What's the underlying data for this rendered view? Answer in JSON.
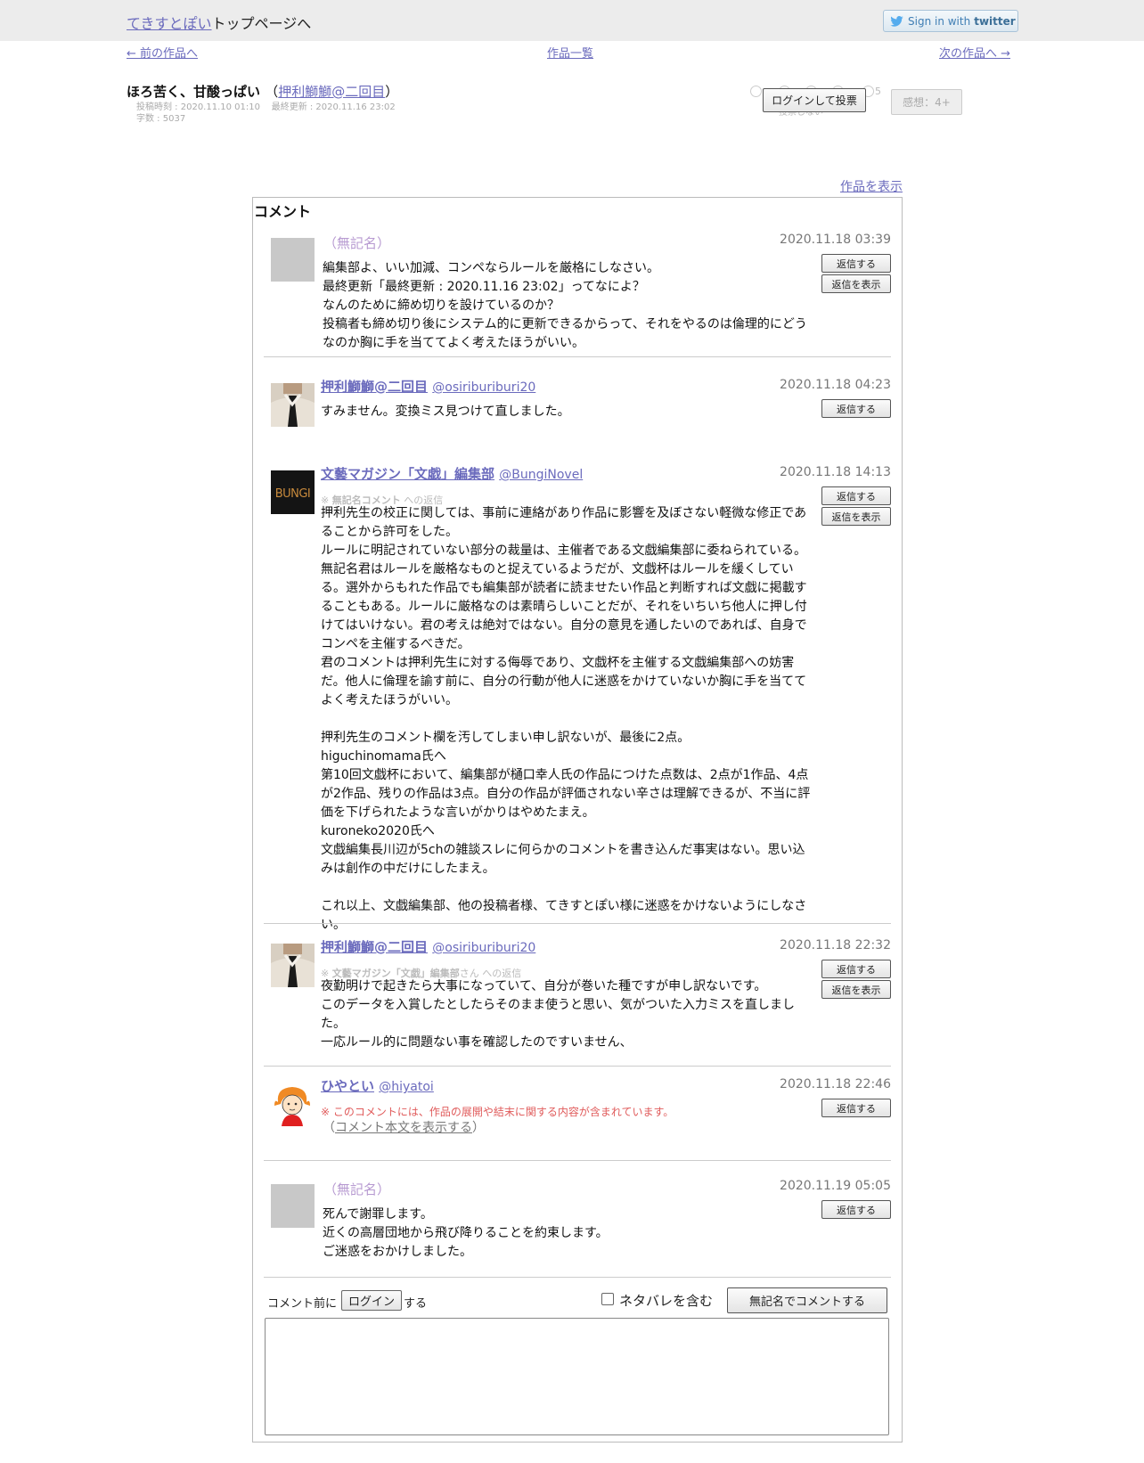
{
  "header": {
    "site_name": "てきすとぽい",
    "site_suffix": "トップページへ",
    "twitter_signin": "Sign in with",
    "twitter_brand": "twitter"
  },
  "nav": {
    "prev": "← 前の作品へ",
    "list": "作品一覧",
    "next": "次の作品へ →"
  },
  "work": {
    "title": "ほろ苦く、甘酸っぱい",
    "paren_open": "（",
    "author": "押利鰤鰤@二回目",
    "paren_close": "）",
    "posted": "投稿時刻 : 2020.11.10 01:10",
    "updated": "最終更新 : 2020.11.16 23:02",
    "chars": "字数 : 5037"
  },
  "vote": {
    "scale_max": "5",
    "no_vote": "投票しない",
    "login_button": "ログインして投票",
    "impression_button": "感想：4+"
  },
  "show_work": "作品を表示",
  "comments_heading": "コメント",
  "comments": [
    {
      "author": "（無記名）",
      "handle": "",
      "date": "2020.11.18 03:39",
      "reply_label": "返信する",
      "show_replies_label": "返信を表示",
      "body": "編集部よ、いい加減、コンペならルールを厳格にしなさい。\n最終更新「最終更新 : 2020.11.16 23:02」ってなによ？\nなんのために締め切りを設けているのか？\n投稿者も締め切り後にシステム的に更新できるからって、それをやるのは倫理的にどうなのか胸に手を当ててよく考えたほうがいい。"
    },
    {
      "author": "押利鰤鰤@二回目",
      "handle": "@osiriburiburi20",
      "date": "2020.11.18 04:23",
      "reply_label": "返信する",
      "body": "すみません。変換ミス見つけて直しました。"
    },
    {
      "author": "文藝マガジン「文戯」編集部",
      "handle": "@BungiNovel",
      "date": "2020.11.18 14:13",
      "reply_label": "返信する",
      "show_replies_label": "返信を表示",
      "reply_to_prefix": "※ ",
      "reply_to_name": "無記名コメント",
      "reply_to_suffix": " への返信",
      "avatar_text": "BUNGI",
      "body": "押利先生の校正に関しては、事前に連絡があり作品に影響を及ぼさない軽微な修正であることから許可をした。\nルールに明記されていない部分の裁量は、主催者である文戯編集部に委ねられている。\n無記名君はルールを厳格なものと捉えているようだが、文戯杯はルールを緩くしている。選外からもれた作品でも編集部が読者に読ませたい作品と判断すれば文戯に掲載することもある。ルールに厳格なのは素晴らしいことだが、それをいちいち他人に押し付けてはいけない。君の考えは絶対ではない。自分の意見を通したいのであれば、自身でコンペを主催するべきだ。\n君のコメントは押利先生に対する侮辱であり、文戯杯を主催する文戯編集部への妨害だ。他人に倫理を諭す前に、自分の行動が他人に迷惑をかけていないか胸に手を当ててよく考えたほうがいい。\n\n押利先生のコメント欄を汚してしまい申し訳ないが、最後に2点。\nhiguchinomama氏へ\n第10回文戯杯において、編集部が樋口幸人氏の作品につけた点数は、2点が1作品、4点が2作品、残りの作品は3点。自分の作品が評価されない辛さは理解できるが、不当に評価を下げられたような言いがかりはやめたまえ。\nkuroneko2020氏へ\n文戯編集長川辺が5chの雑談スレに何らかのコメントを書き込んだ事実はない。思い込みは創作の中だけにしたまえ。\n\nこれ以上、文戯編集部、他の投稿者様、てきすとぽい様に迷惑をかけないようにしなさい。"
    },
    {
      "author": "押利鰤鰤@二回目",
      "handle": "@osiriburiburi20",
      "date": "2020.11.18 22:32",
      "reply_label": "返信する",
      "show_replies_label": "返信を表示",
      "reply_to_prefix": "※ ",
      "reply_to_name": "文藝マガジン「文戯」編集部",
      "reply_to_suffix": "さん への返信",
      "body": "夜勤明けで起きたら大事になっていて、自分が巻いた種ですが申し訳ないです。\nこのデータを入賞したとしたらそのまま使うと思い、気がついた入力ミスを直しました。\n一応ルール的に問題ない事を確認したのですいません、"
    },
    {
      "author": "ひやとい",
      "handle": "@hiyatoi",
      "date": "2020.11.18 22:46",
      "reply_label": "返信する",
      "spoiler_note": "※ このコメントには、作品の展開や結末に関する内容が含まれています。",
      "show_body_open": "（",
      "show_body_link": "コメント本文を表示する",
      "show_body_close": "）"
    },
    {
      "author": "（無記名）",
      "handle": "",
      "date": "2020.11.19 05:05",
      "reply_label": "返信する",
      "body": "死んで謝罪します。\n近くの高層団地から飛び降りることを約束します。\nご迷惑をおかけしました。"
    }
  ],
  "comment_form": {
    "pre": "コメント前に",
    "login_button": "ログイン",
    "post": "する",
    "spoiler_label": "ネタバレを含む",
    "spoiler_checked": false,
    "anon_submit": "無記名でコメントする",
    "textarea_value": ""
  },
  "colors": {
    "link": "#6b6bbd",
    "anon_name": "#b79ad1",
    "spoiler": "#e05b5b",
    "topbar": "#ececec"
  }
}
